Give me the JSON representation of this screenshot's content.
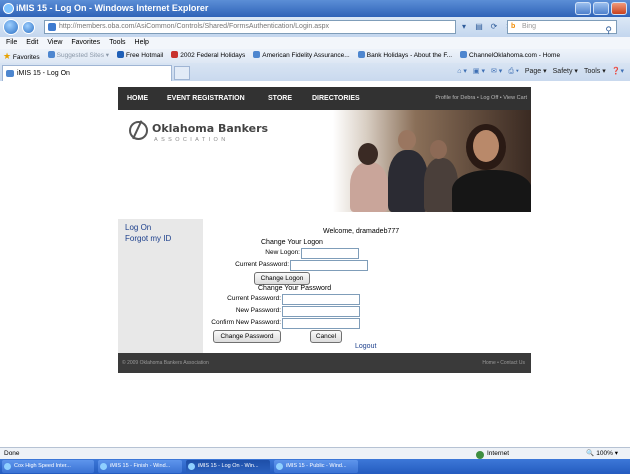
{
  "browser": {
    "title": "iMIS 15 - Log On - Windows Internet Explorer",
    "address": "http://members.oba.com/AsiCommon/Controls/Shared/FormsAuthentication/Login.aspx",
    "address_host": "oba.com",
    "search_placeholder": "Bing",
    "menu": [
      "File",
      "Edit",
      "View",
      "Favorites",
      "Tools",
      "Help"
    ],
    "favorites_label": "Favorites",
    "favorites": [
      "Suggested Sites ▾",
      "Free Hotmail",
      "2002 Federal Holidays",
      "American Fidelity Assurance...",
      "Bank Holidays - About the F...",
      "ChannelOklahoma.com - Home"
    ],
    "tab_label": "iMIS 15 - Log On",
    "commands": [
      "Page ▾",
      "Safety ▾",
      "Tools ▾"
    ]
  },
  "site": {
    "nav": [
      "HOME",
      "EVENT REGISTRATION",
      "STORE",
      "DIRECTORIES"
    ],
    "nav_right": "Profile for Debra • Log Off • View Cart",
    "logo_name": "Oklahoma Bankers",
    "logo_assoc": "ASSOCIATION",
    "sidebar": [
      "Log On",
      "Forgot my ID"
    ],
    "welcome": "Welcome, dramadeb777",
    "logon_section": {
      "title": "Change Your Logon",
      "new_logon_label": "New Logon:",
      "current_password_label": "Current Password:",
      "button": "Change Logon"
    },
    "password_section": {
      "title": "Change Your Password",
      "current_label": "Current Password:",
      "new_label": "New Password:",
      "confirm_label": "Confirm New Password:",
      "change_button": "Change Password",
      "cancel_button": "Cancel"
    },
    "logout": "Logout",
    "footer_left": "© 2009 Oklahoma Bankers Association",
    "footer_right": "Home • Contact Us"
  },
  "status": {
    "left": "Done",
    "zone": "Internet",
    "zoom": "100%"
  },
  "taskbar": [
    "Cox High Speed Inter...",
    "iMIS 15 - Finish - Wind...",
    "iMIS 15 - Log On - Win...",
    "iMIS 15 - Public - Wind..."
  ]
}
